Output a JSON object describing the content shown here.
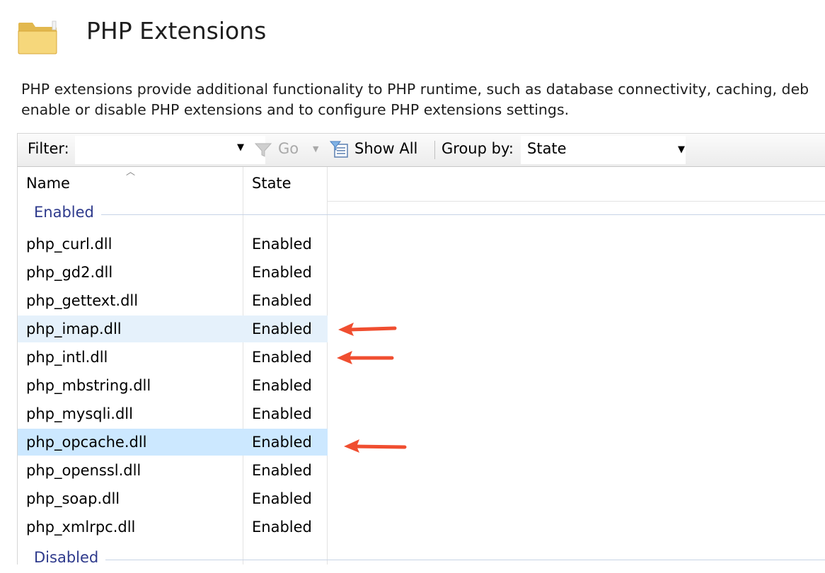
{
  "header": {
    "title": "PHP Extensions",
    "icon": "folder-icon"
  },
  "description": {
    "line1": "PHP extensions provide additional functionality to PHP runtime, such as database connectivity, caching, deb",
    "line2": "enable or disable PHP extensions and to configure PHP extensions settings."
  },
  "toolbar": {
    "filter_label": "Filter:",
    "filter_value": "",
    "go_label": "Go",
    "show_all_label": "Show All",
    "group_by_label": "Group by:",
    "group_by_value": "State"
  },
  "columns": {
    "name": "Name",
    "state": "State"
  },
  "groups": [
    {
      "label": "Enabled",
      "rows": [
        {
          "name": "php_curl.dll",
          "state": "Enabled"
        },
        {
          "name": "php_gd2.dll",
          "state": "Enabled"
        },
        {
          "name": "php_gettext.dll",
          "state": "Enabled"
        },
        {
          "name": "php_imap.dll",
          "state": "Enabled"
        },
        {
          "name": "php_intl.dll",
          "state": "Enabled"
        },
        {
          "name": "php_mbstring.dll",
          "state": "Enabled"
        },
        {
          "name": "php_mysqli.dll",
          "state": "Enabled"
        },
        {
          "name": "php_opcache.dll",
          "state": "Enabled"
        },
        {
          "name": "php_openssl.dll",
          "state": "Enabled"
        },
        {
          "name": "php_soap.dll",
          "state": "Enabled"
        },
        {
          "name": "php_xmlrpc.dll",
          "state": "Enabled"
        }
      ]
    },
    {
      "label": "Disabled",
      "rows": []
    }
  ],
  "colors": {
    "annotation_arrow": "#f04e30",
    "group_text": "#2e3a8c",
    "hover_row": "#e5f1fb",
    "selected_row": "#cce8ff"
  }
}
